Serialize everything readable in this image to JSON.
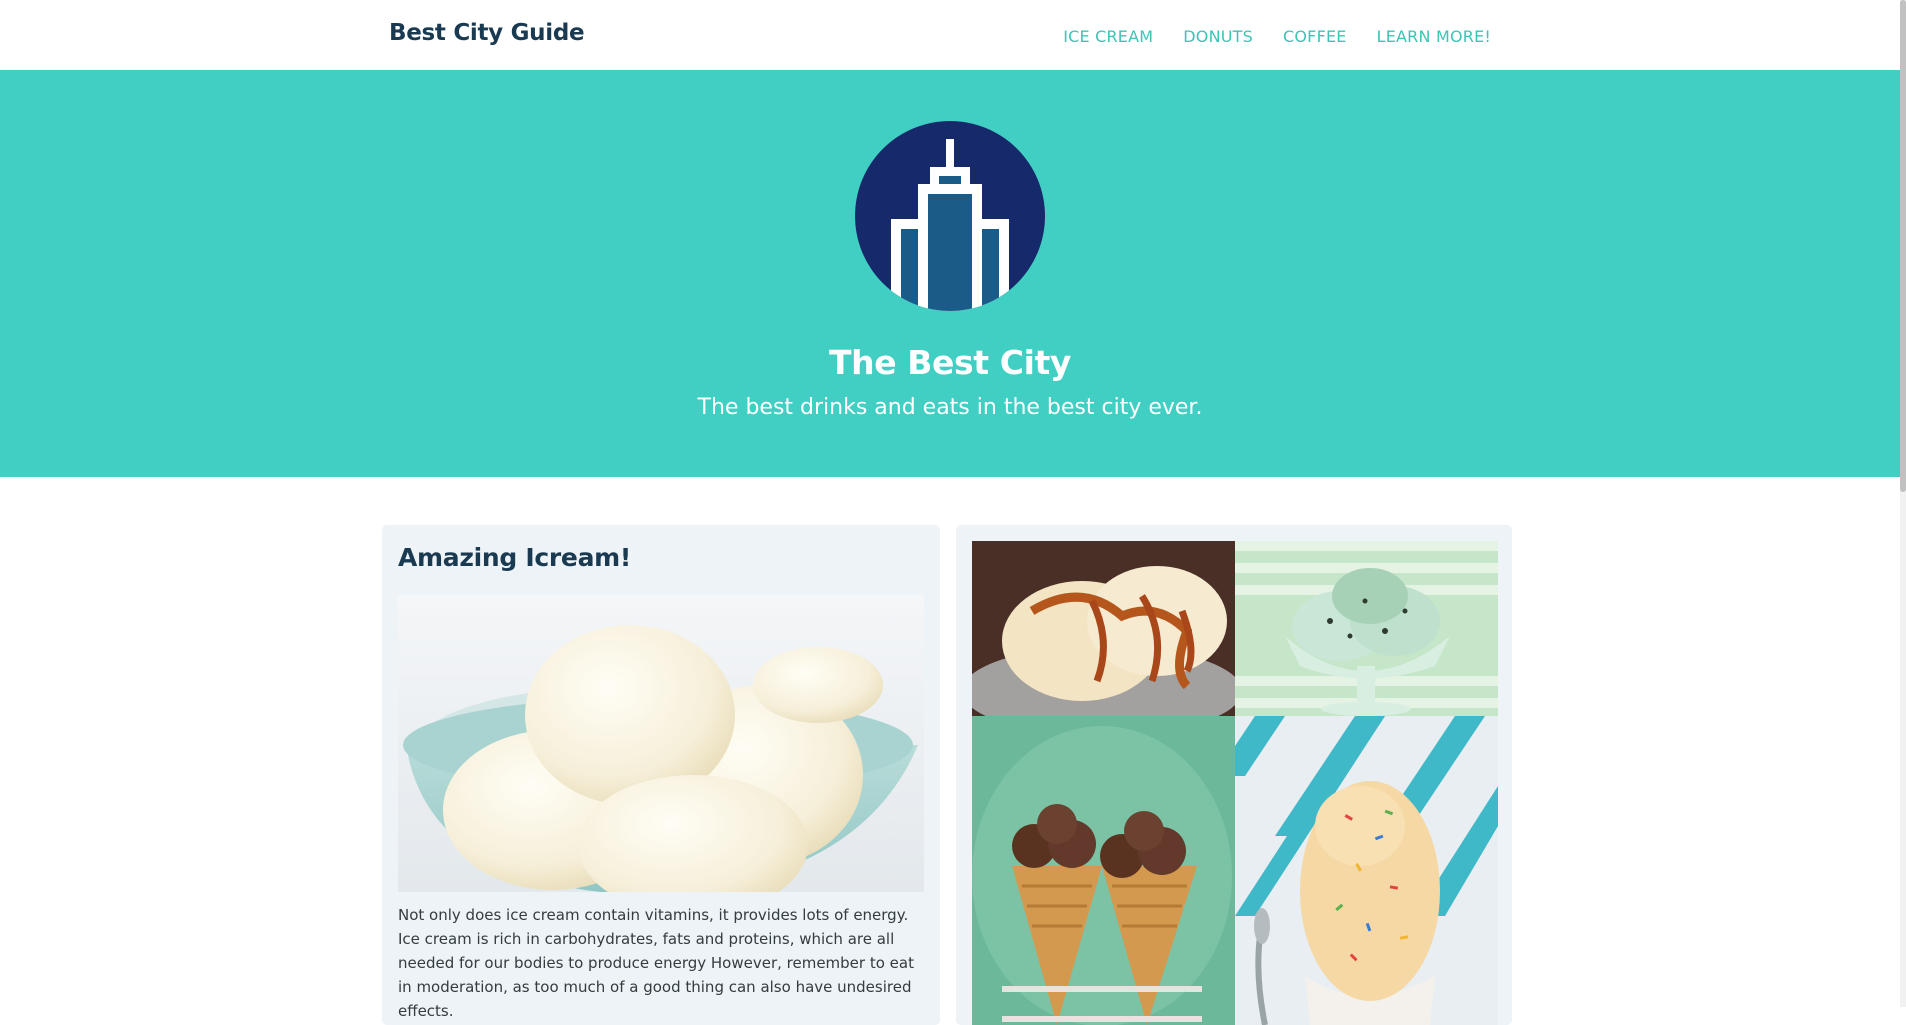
{
  "nav": {
    "brand": "Best City Guide",
    "links": [
      "ICE CREAM",
      "DONUTS",
      "COFFEE",
      "LEARN MORE!"
    ]
  },
  "hero": {
    "logo_icon": "skyscraper-icon",
    "title": "The Best City",
    "subtitle": "The best drinks and eats in the best city ever."
  },
  "featured": {
    "title": "Amazing Icream!",
    "image": "vanilla-ice-cream-bowl-photo",
    "body": "Not only does ice cream contain vitamins, it provides lots of energy. Ice cream is rich in carbohydrates, fats and proteins, which are all needed for our bodies to produce energy However, remember to eat in moderation, as too much of a good thing can also have undesired effects."
  },
  "gallery": {
    "images": [
      "caramel-sundae-photo",
      "mint-chip-ice-cream-photo",
      "chocolate-cones-photo",
      "sprinkles-ice-cream-photo"
    ]
  },
  "colors": {
    "accent": "#42cfc3",
    "nav_link": "#3cc4b5",
    "brand_text": "#1a3a52",
    "card_bg": "#edf3f6",
    "logo_circle": "#16296a",
    "logo_building": "#1b5b88"
  }
}
